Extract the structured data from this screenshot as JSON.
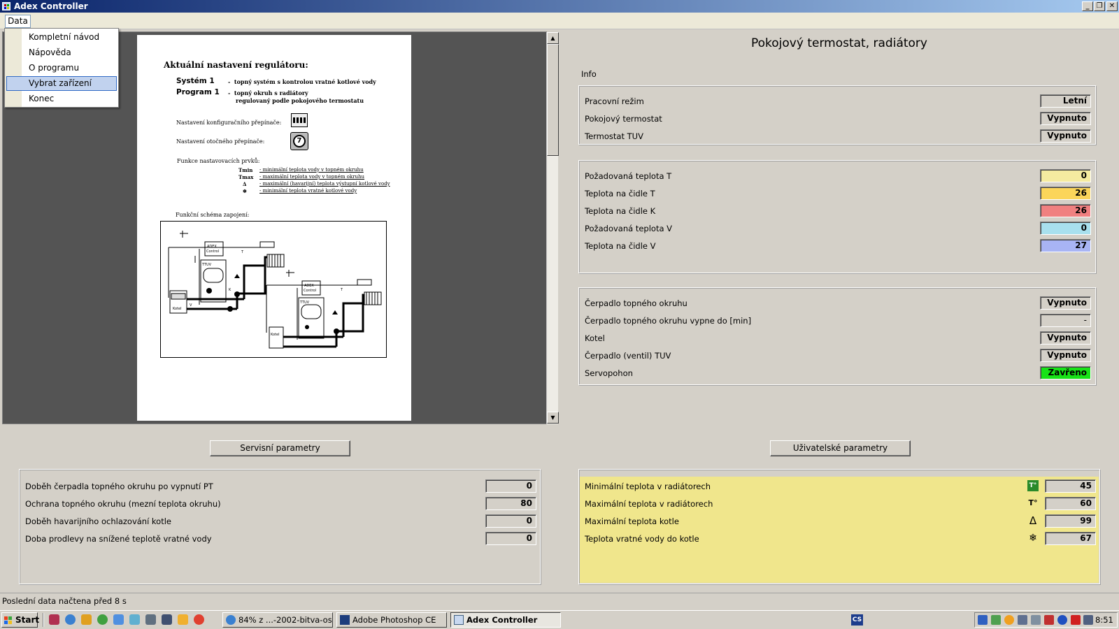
{
  "window": {
    "title": "Adex Controller"
  },
  "menu": {
    "data_label": "Data",
    "items": [
      {
        "label": "Kompletní návod"
      },
      {
        "label": "Nápověda"
      },
      {
        "label": "O programu"
      },
      {
        "label": "Vybrat zařízení"
      },
      {
        "label": "Konec"
      }
    ]
  },
  "document": {
    "heading": "Aktuální nastavení regulátoru:",
    "system_label": "Systém 1",
    "system_desc": "topný systém s kontrolou vratné kotlové vody",
    "program_label": "Program 1",
    "program_desc_1": "topný okruh s radiátory",
    "program_desc_2": "regulovaný podle pokojového termostatu",
    "config_switch": "Nastavení konfiguračního přepínače:",
    "rotary_switch": "Nastavení otočného přepínače:",
    "rotary_value": "7",
    "functions_title": "Funkce nastavovacích prvků:",
    "functions": [
      {
        "sym": "Tmin",
        "desc": "- minimální teplota vody v topném okruhu"
      },
      {
        "sym": "Tmax",
        "desc": "- maximální teplota vody v topném okruhu"
      },
      {
        "sym": "Δ",
        "desc": "- maximální (havarijní) teplota výstupní kotlové vody"
      },
      {
        "sym": "❄",
        "desc": "- minimální teplota vratné kotlové vody"
      }
    ],
    "schema_title": "Funkční schéma zapojení:",
    "diagram": {
      "adex": "ADEX",
      "control": "Control",
      "ttuv": "TTUV",
      "kotel": "Kotel",
      "t": "T",
      "k": "K",
      "v": "V"
    }
  },
  "panel": {
    "title": "Pokojový termostat, radiátory",
    "info_label": "Info",
    "status_rows": [
      {
        "label": "Pracovní režim",
        "value": "Letní"
      },
      {
        "label": "Pokojový termostat",
        "value": "Vypnuto"
      },
      {
        "label": "Termostat TUV",
        "value": "Vypnuto"
      }
    ],
    "temp_rows": [
      {
        "label": "Požadovaná teplota T",
        "value": "0",
        "color": "#f5eba0"
      },
      {
        "label": "Teplota na čidle T",
        "value": "26",
        "color": "#fbd55a"
      },
      {
        "label": "Teplota na čidle K",
        "value": "26",
        "color": "#f08080"
      },
      {
        "label": "Požadovaná teplota V",
        "value": "0",
        "color": "#a8e0ee"
      },
      {
        "label": "Teplota na čidle V",
        "value": "27",
        "color": "#a8b4f4"
      }
    ],
    "device_rows": [
      {
        "label": "Čerpadlo topného okruhu",
        "value": "Vypnuto"
      },
      {
        "label": "Čerpadlo topného okruhu vypne do [min]",
        "value": "-"
      },
      {
        "label": "Kotel",
        "value": "Vypnuto"
      },
      {
        "label": "Čerpadlo (ventil) TUV",
        "value": "Vypnuto"
      },
      {
        "label": "Servopohon",
        "value": "Zavřeno",
        "color": "#17e317"
      }
    ]
  },
  "buttons": {
    "service": "Servisní parametry",
    "user": "Uživatelské parametry"
  },
  "service_params": [
    {
      "label": "Doběh čerpadla topného okruhu po vypnutí PT",
      "value": "0"
    },
    {
      "label": "Ochrana topného okruhu (mezní teplota okruhu)",
      "value": "80"
    },
    {
      "label": "Doběh havarijního ochlazování kotle",
      "value": "0"
    },
    {
      "label": "Doba prodlevy na snížené teplotě vratné vody",
      "value": "0"
    }
  ],
  "user_params": [
    {
      "label": "Minimální teplota v radiátorech",
      "value": "45",
      "icon": "tmin-icon"
    },
    {
      "label": "Maximální teplota v radiátorech",
      "value": "60",
      "icon": "tmax-icon"
    },
    {
      "label": "Maximální teplota kotle",
      "value": "99",
      "icon": "delta-icon"
    },
    {
      "label": "Teplota vratné vody do kotle",
      "value": "67",
      "icon": "snowflake-icon"
    }
  ],
  "user_panel_color": "#f0e68c",
  "status_bar": {
    "text": "Poslední data načtena před 8 s"
  },
  "taskbar": {
    "start": "Start",
    "tasks": [
      {
        "label": "84% z ...-2002-bitva-os..."
      },
      {
        "label": "Adobe Photoshop CE"
      },
      {
        "label": "Adex Controller"
      }
    ],
    "lang": "CS",
    "clock": "8:51"
  }
}
